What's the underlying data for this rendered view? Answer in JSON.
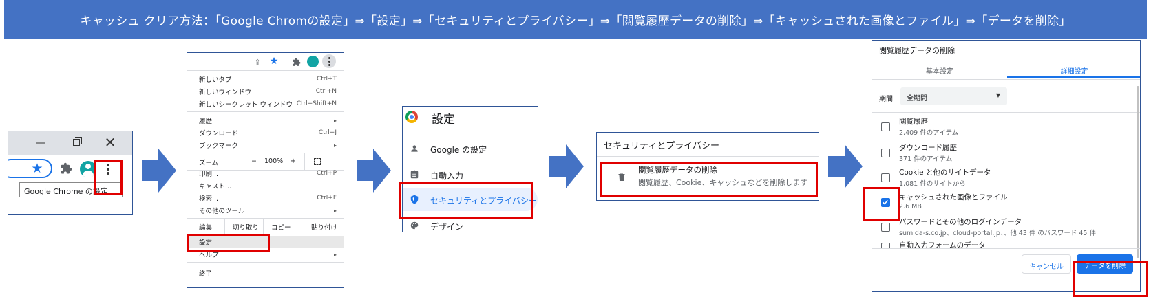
{
  "banner": {
    "text": "キャッシュ クリア方法：「Google Chromの設定」⇒「設定」⇒「セキュリティとプライバシー」⇒「閲覧履歴データの削除」⇒「キャッシュされた画像とファイル」⇒「データを削除」"
  },
  "step1": {
    "tooltip": "Google Chrome の設定"
  },
  "step2": {
    "items": [
      {
        "label": "新しいタブ",
        "shortcut": "Ctrl+T"
      },
      {
        "label": "新しいウィンドウ",
        "shortcut": "Ctrl+N"
      },
      {
        "label": "新しいシークレット ウィンドウ",
        "shortcut": "Ctrl+Shift+N"
      },
      {
        "label": "履歴",
        "chev": "▸"
      },
      {
        "label": "ダウンロード",
        "shortcut": "Ctrl+J"
      },
      {
        "label": "ブックマーク",
        "chev": "▸"
      }
    ],
    "zoom": {
      "label": "ズーム",
      "minus": "−",
      "value": "100%",
      "plus": "+"
    },
    "items2": [
      {
        "label": "印刷...",
        "shortcut": "Ctrl+P"
      },
      {
        "label": "キャスト..."
      },
      {
        "label": "検索...",
        "shortcut": "Ctrl+F"
      },
      {
        "label": "その他のツール",
        "chev": "▸"
      }
    ],
    "edit": {
      "label": "編集",
      "cut": "切り取り",
      "copy": "コピー",
      "paste": "貼り付け"
    },
    "settings": "設定",
    "help": {
      "label": "ヘルプ",
      "chev": "▸"
    },
    "exit": "終了"
  },
  "step3": {
    "title": "設定",
    "items": [
      {
        "label": "Google の設定",
        "icon": "person-icon"
      },
      {
        "label": "自動入力",
        "icon": "clipboard-icon"
      },
      {
        "label": "セキュリティとプライバシー",
        "icon": "shield-icon"
      },
      {
        "label": "デザイン",
        "icon": "palette-icon"
      }
    ]
  },
  "step4": {
    "header": "セキュリティとプライバシー",
    "title": "閲覧履歴データの削除",
    "desc": "閲覧履歴、Cookie、キャッシュなどを削除します"
  },
  "step5": {
    "title": "閲覧履歴データの削除",
    "tabs": {
      "basic": "基本設定",
      "advanced": "詳細設定"
    },
    "period_label": "期間",
    "period_value": "全期間",
    "items": [
      {
        "title": "閲覧履歴",
        "sub": "2,409 件のアイテム",
        "checked": false
      },
      {
        "title": "ダウンロード履歴",
        "sub": "371 件のアイテム",
        "checked": false
      },
      {
        "title": "Cookie と他のサイトデータ",
        "sub": "1,081 件のサイトから",
        "checked": false
      },
      {
        "title": "キャッシュされた画像とファイル",
        "sub": "2.6 MB",
        "checked": true
      },
      {
        "title": "パスワードとその他のログインデータ",
        "sub": "sumida-s.co.jp、cloud-portal.jp、、他 43 件 のパスワード 45 件",
        "checked": false
      },
      {
        "title": "自動入力フォームのデータ",
        "sub": "",
        "checked": false
      }
    ],
    "cancel": "キャンセル",
    "delete": "データを削除"
  },
  "colors": {
    "banner": "#4472c4",
    "arrow": "#4472c4",
    "highlight": "#e00000",
    "chrome_blue": "#1a73e8"
  }
}
